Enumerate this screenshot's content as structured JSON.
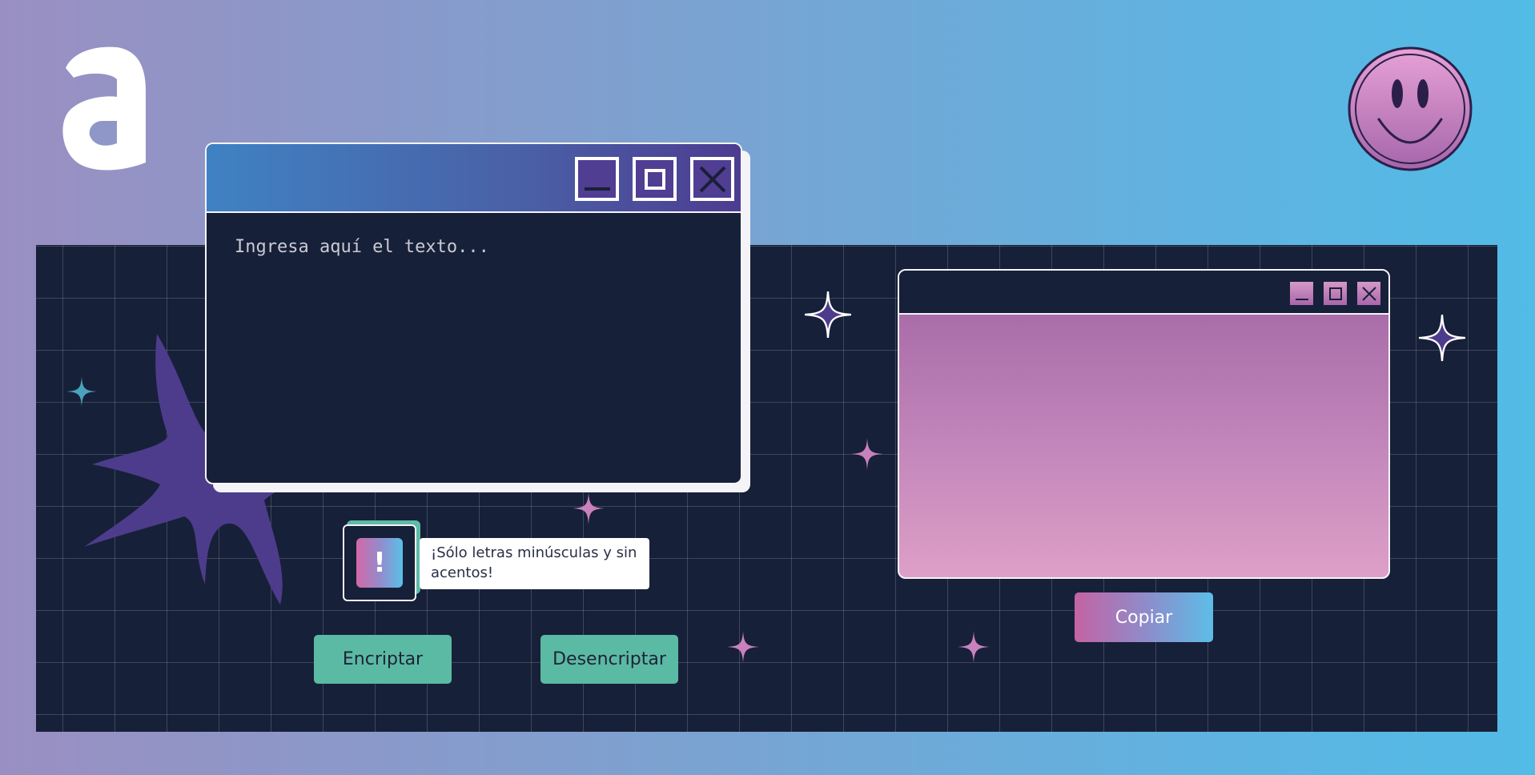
{
  "app": {
    "logo_letter": "a"
  },
  "input_window": {
    "placeholder": "Ingresa aquí el texto...",
    "value": "",
    "buttons": [
      "minimize-icon",
      "maximize-icon",
      "close-icon"
    ]
  },
  "output_window": {
    "value": "",
    "buttons": [
      "minimize-icon",
      "maximize-icon",
      "close-icon"
    ]
  },
  "warning": {
    "icon_glyph": "!",
    "text": "¡Sólo letras minúsculas y sin acentos!"
  },
  "actions": {
    "encrypt_label": "Encriptar",
    "decrypt_label": "Desencriptar",
    "copy_label": "Copiar"
  },
  "colors": {
    "background_start": "#9a8fc2",
    "background_end": "#52bbe6",
    "board": "#172039",
    "accent_green": "#5bbaa4",
    "accent_pink": "#c463a4",
    "accent_purple": "#4d3c91"
  }
}
